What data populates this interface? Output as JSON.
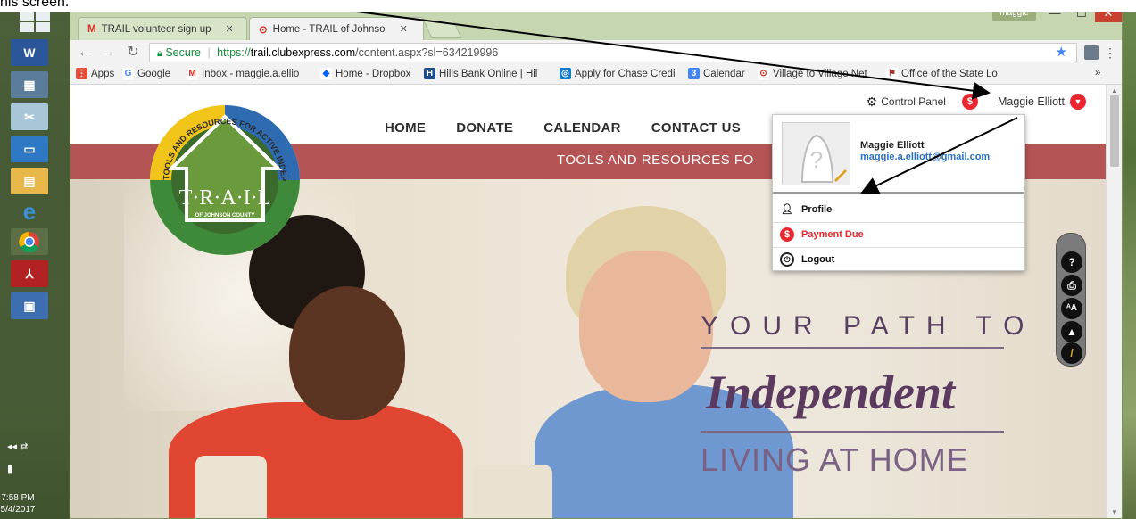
{
  "top_partial_text": "his screen.",
  "taskbar": {
    "time": "7:58 PM",
    "date": "5/4/2017"
  },
  "browser": {
    "user_pill": "maggie",
    "tabs": [
      {
        "label": "TRAIL volunteer sign up",
        "favicon": "gmail-icon",
        "active": false
      },
      {
        "label": "Home - TRAIL of Johnso",
        "favicon": "trail-icon",
        "active": true
      }
    ],
    "address": {
      "secure_label": "Secure",
      "scheme": "https://",
      "host": "trail.clubexpress.com",
      "path": "/content.aspx?sl=634219996"
    },
    "bookmarks": [
      {
        "label": "Apps",
        "icon": "apps-grid-icon"
      },
      {
        "label": "Google",
        "icon": "google-icon"
      },
      {
        "label": "Inbox - maggie.a.ellio",
        "icon": "gmail-icon"
      },
      {
        "label": "Home - Dropbox",
        "icon": "dropbox-icon"
      },
      {
        "label": "Hills Bank Online | Hil",
        "icon": "bank-icon"
      },
      {
        "label": "Apply for Chase Credi",
        "icon": "chase-icon"
      },
      {
        "label": "Calendar",
        "icon": "calendar-icon"
      },
      {
        "label": "Village to Village Net",
        "icon": "village-icon"
      },
      {
        "label": "Office of the State Lo",
        "icon": "office-icon"
      }
    ],
    "bookmarks_more": "»"
  },
  "site": {
    "utility": {
      "control_panel": "Control Panel",
      "user_name": "Maggie Elliott"
    },
    "nav": [
      "HOME",
      "DONATE",
      "CALENDAR",
      "CONTACT US"
    ],
    "tagline": "TOOLS AND RESOURCES FO",
    "logo": {
      "ring_text": "TOOLS AND RESOURCES FOR ACTIVE INDEPENDENT LIVING",
      "wordmark": "T·R·A·I·L",
      "subtitle": "OF JOHNSON COUNTY"
    },
    "hero": {
      "line1": "YOUR PATH TO",
      "line2": "Independent",
      "line3": "LIVING AT HOME"
    },
    "dropdown": {
      "name": "Maggie Elliott",
      "email": "maggie.a.elliott@gmail.com",
      "items": [
        {
          "label": "Profile",
          "icon": "person-icon",
          "color": "#111111"
        },
        {
          "label": "Payment Due",
          "icon": "dollar-icon",
          "color": "#e8282e"
        },
        {
          "label": "Logout",
          "icon": "power-icon",
          "color": "#111111"
        }
      ]
    },
    "accessibility": [
      "help-icon",
      "print-icon",
      "text-size-icon",
      "navigate-icon",
      "highlight-icon"
    ]
  },
  "colors": {
    "brand_red": "#b55454",
    "badge_red": "#e8282e",
    "hero_purple": "#5a3a5e",
    "link_blue": "#2a6fc9"
  }
}
